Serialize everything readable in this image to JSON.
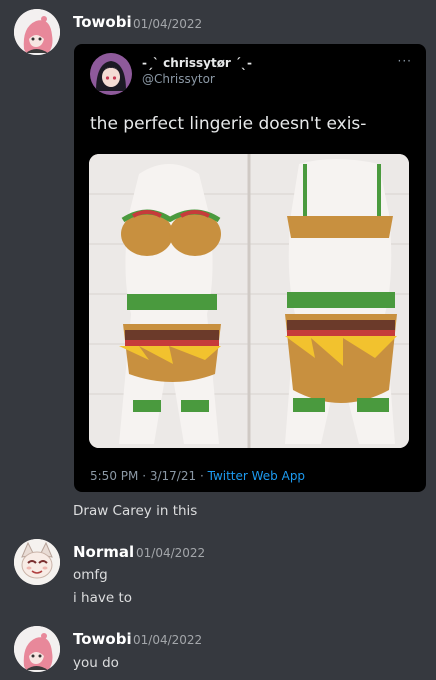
{
  "messages": [
    {
      "username": "Towobi",
      "timestamp": "01/04/2022",
      "tweet": {
        "display_name": "-ˏˋ chrissytør ˊˎ-",
        "handle": "@Chrissytor",
        "more": "···",
        "body": "the perfect lingerie doesn't exis-",
        "time": "5:50 PM",
        "sep1": "·",
        "date": "3/17/21",
        "sep2": "·",
        "app": "Twitter Web App"
      },
      "text": "Draw Carey in this"
    },
    {
      "username": "Normal",
      "timestamp": "01/04/2022",
      "lines": [
        "omfg",
        "i have to"
      ]
    },
    {
      "username": "Towobi",
      "timestamp": "01/04/2022",
      "lines": [
        "you do"
      ]
    }
  ],
  "colors": {
    "background": "#36393f",
    "username": "#ffffff",
    "timestamp": "#a3a6aa",
    "message_text": "#dcddde",
    "twitter_link": "#1d9bf0"
  }
}
